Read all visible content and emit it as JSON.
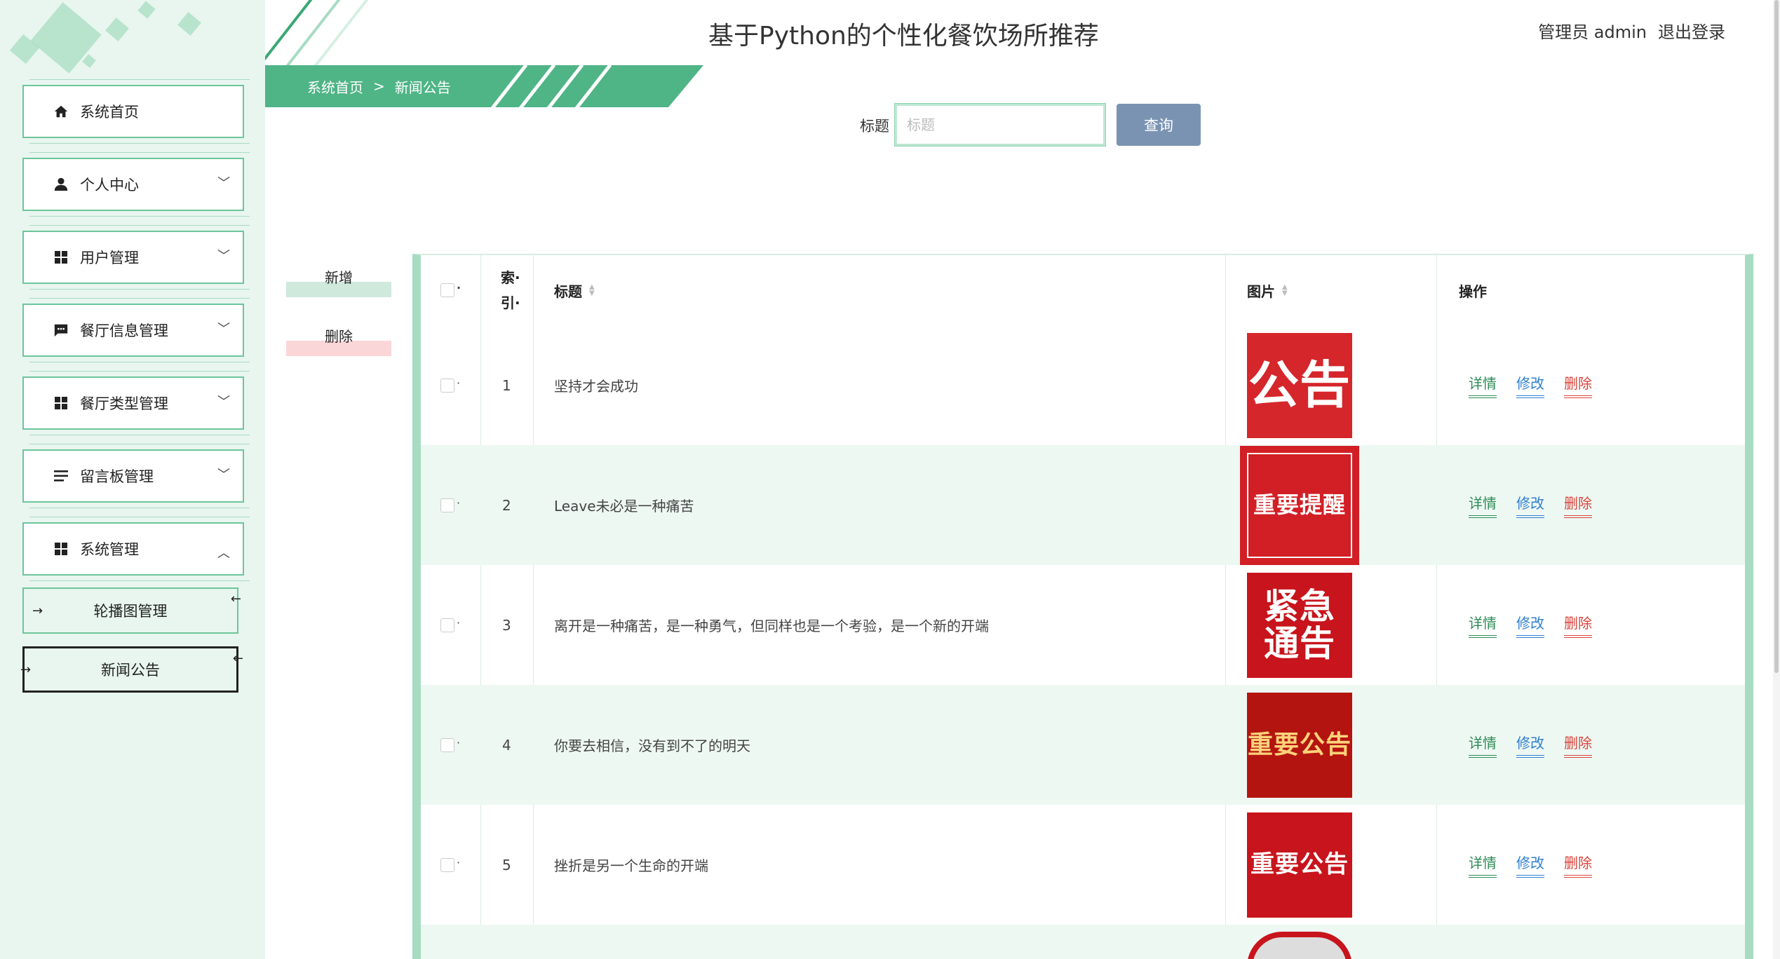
{
  "header": {
    "title": "基于Python的个性化餐饮场所推荐",
    "user": "管理员 admin",
    "logout": "退出登录"
  },
  "breadcrumb": {
    "home": "系统首页",
    "sep": ">",
    "current": "新闻公告"
  },
  "sidebar": {
    "items": [
      {
        "label": "系统首页",
        "icon": "home-icon"
      },
      {
        "label": "个人中心",
        "icon": "user-icon"
      },
      {
        "label": "用户管理",
        "icon": "grid-icon"
      },
      {
        "label": "餐厅信息管理",
        "icon": "chat-icon"
      },
      {
        "label": "餐厅类型管理",
        "icon": "grid-icon"
      },
      {
        "label": "留言板管理",
        "icon": "list-icon"
      },
      {
        "label": "系统管理",
        "icon": "grid-icon"
      }
    ],
    "sub_items": [
      {
        "label": "轮播图管理"
      },
      {
        "label": "新闻公告"
      }
    ]
  },
  "search": {
    "label": "标题",
    "placeholder": "标题",
    "value": "",
    "button": "查询"
  },
  "actions": {
    "add": "新增",
    "delete": "删除"
  },
  "table": {
    "headers": {
      "index": "索·引·",
      "title": "标题",
      "image": "图片",
      "ops": "操作"
    },
    "rows": [
      {
        "index": "1",
        "title": "坚持才会成功",
        "image_text": "公告",
        "image_color": "#d5262b"
      },
      {
        "index": "2",
        "title": "Leave未必是一种痛苦",
        "image_text": "重要提醒",
        "image_color": "#d11f25"
      },
      {
        "index": "3",
        "title": "离开是一种痛苦，是一种勇气，但同样也是一个考验，是一个新的开端",
        "image_text": "紧急通告",
        "image_color": "#c8141c"
      },
      {
        "index": "4",
        "title": "你要去相信，没有到不了的明天",
        "image_text": "重要公告",
        "image_color": "#b4140f"
      },
      {
        "index": "5",
        "title": "挫折是另一个生命的开端",
        "image_text": "重要公告",
        "image_color": "#c8141c"
      }
    ],
    "row_ops": {
      "detail": "详情",
      "edit": "修改",
      "delete": "删除"
    }
  },
  "colors": {
    "primary": "#4fb486",
    "sidebar_bg": "#e8f6ef",
    "search_button": "#7a93b3",
    "delete": "#d9443b",
    "edit": "#2f7fd1"
  }
}
